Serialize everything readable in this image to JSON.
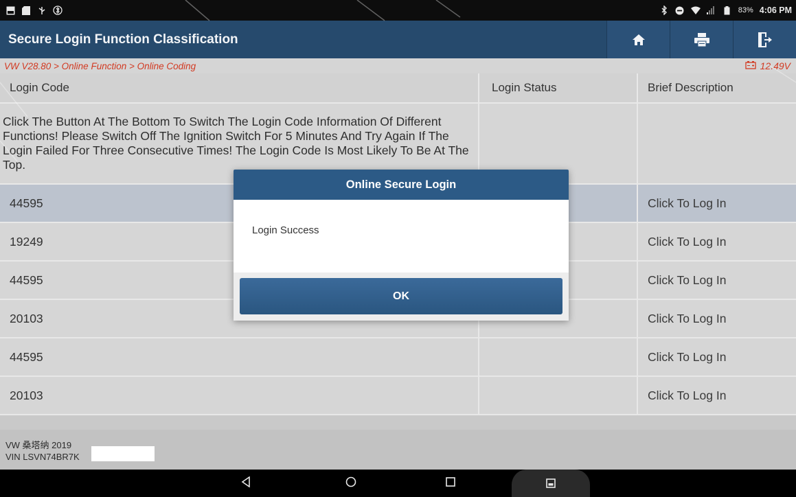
{
  "status_bar": {
    "battery_percent": "83%",
    "time": "4:06 PM",
    "icons_left": [
      "image-icon",
      "sd-card-icon",
      "usb-icon",
      "bluetooth-settings-icon"
    ],
    "icons_right": [
      "bluetooth-icon",
      "do-not-disturb-icon",
      "wifi-icon",
      "signal-icon",
      "battery-icon"
    ]
  },
  "header": {
    "title": "Secure Login Function Classification",
    "buttons": [
      "home-icon",
      "print-icon",
      "exit-icon"
    ]
  },
  "breadcrumb": {
    "path": "VW V28.80 > Online Function > Online Coding",
    "voltage": "12.49V"
  },
  "table": {
    "columns": [
      "Login Code",
      "Login Status",
      "Brief Description"
    ],
    "info_text": "Click The Button At The Bottom To Switch The Login Code Information Of Different Functions! Please Switch Off The Ignition Switch For 5 Minutes And Try Again If The Login Failed For Three Consecutive Times! The Login Code Is Most Likely To Be At The Top.",
    "rows": [
      {
        "code": "44595",
        "status": "",
        "description": "Click To Log In"
      },
      {
        "code": "19249",
        "status": "",
        "description": "Click To Log In"
      },
      {
        "code": "44595",
        "status": "",
        "description": "Click To Log In"
      },
      {
        "code": "20103",
        "status": "",
        "description": "Click To Log In"
      },
      {
        "code": "44595",
        "status": "",
        "description": "Click To Log In"
      },
      {
        "code": "20103",
        "status": "",
        "description": "Click To Log In"
      }
    ]
  },
  "vehicle": {
    "model": "VW 桑塔纳 2019",
    "vin": "VIN LSVN74BR7K"
  },
  "dialog": {
    "title": "Online Secure Login",
    "message": "Login Success",
    "ok_label": "OK"
  },
  "colors": {
    "header_bg": "#264a6d",
    "dialog_header": "#2c5a86",
    "breadcrumb_text": "#d23a22",
    "selected_row": "#bcc3ce"
  }
}
